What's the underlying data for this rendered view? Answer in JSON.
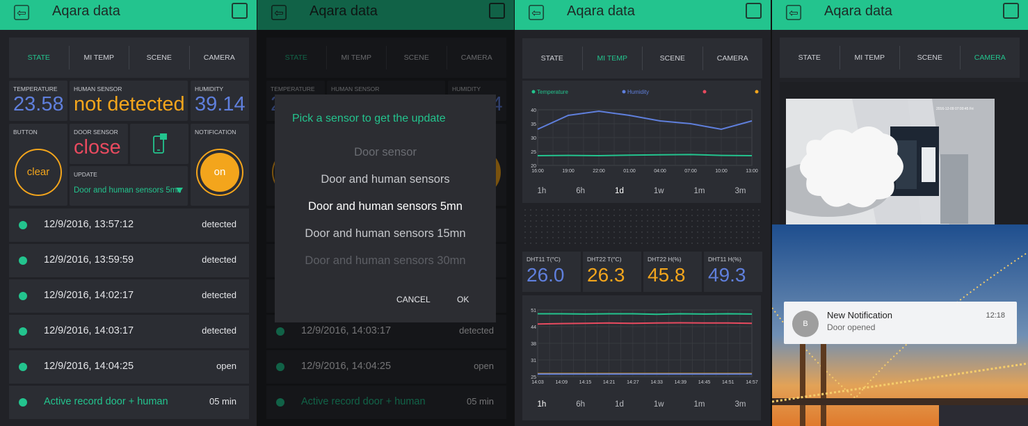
{
  "app": {
    "title": "Aqara data"
  },
  "tabs": [
    "STATE",
    "MI TEMP",
    "SCENE",
    "CAMERA"
  ],
  "state": {
    "temperature_label": "TEMPERATURE",
    "temperature": "23.58",
    "human_label": "HUMAN SENSOR",
    "human": "not detected",
    "humidity_label": "HUMIDITY",
    "humidity": "39.14",
    "button_label": "BUTTON",
    "button_value": "clear",
    "door_label": "DOOR SENSOR",
    "door": "close",
    "notification_label": "NOTIFICATION",
    "notification_value": "on",
    "update_label": "UPDATE",
    "update_value": "Door and human sensors 5mn",
    "records": [
      {
        "time": "12/9/2016, 13:57:12",
        "value": "detected"
      },
      {
        "time": "12/9/2016, 13:59:59",
        "value": "detected"
      },
      {
        "time": "12/9/2016, 14:02:17",
        "value": "detected"
      },
      {
        "time": "12/9/2016, 14:03:17",
        "value": "detected"
      },
      {
        "time": "12/9/2016, 14:04:25",
        "value": "open"
      }
    ],
    "active_label": "Active record door + human",
    "active_value": "05 min"
  },
  "dialog": {
    "title": "Pick a sensor to get the update",
    "options": [
      "Door sensor",
      "Door and human sensors",
      "Door and human sensors 5mn",
      "Door and human sensors 15mn",
      "Door and human sensors 30mn"
    ],
    "selected": "Door and human sensors 5mn",
    "cancel": "CANCEL",
    "ok": "OK"
  },
  "mitemp": {
    "ranges": [
      "1h",
      "6h",
      "1d",
      "1w",
      "1m",
      "3m"
    ],
    "selected_range_top": "1d",
    "selected_range_bottom": "1h",
    "values": [
      {
        "label": "DHT11 T(°C)",
        "value": "26.0",
        "color": "#5f7fdc"
      },
      {
        "label": "DHT22 T(°C)",
        "value": "26.3",
        "color": "#f3a51c"
      },
      {
        "label": "DHT22 H(%)",
        "value": "45.8",
        "color": "#f3a51c"
      },
      {
        "label": "DHT11 H(%)",
        "value": "49.3",
        "color": "#5f7fdc"
      }
    ]
  },
  "chart_data": [
    {
      "type": "line",
      "title": "",
      "x": [
        "16:00",
        "19:00",
        "22:00",
        "01:00",
        "04:00",
        "07:00",
        "10:00",
        "13:00"
      ],
      "ylim": [
        20,
        40
      ],
      "yticks": [
        "20",
        "25",
        "30",
        "35",
        "40"
      ],
      "series": [
        {
          "name": "Temperature",
          "color": "#23c48e",
          "values": [
            23.5,
            23.6,
            23.5,
            23.7,
            23.8,
            23.9,
            23.6,
            23.5
          ]
        },
        {
          "name": "Humidity",
          "color": "#5f7fdc",
          "values": [
            33,
            38,
            39.5,
            38,
            36,
            35,
            33,
            36
          ]
        },
        {
          "color": "#e84a5f",
          "values": []
        },
        {
          "color": "#f3a51c",
          "values": []
        }
      ]
    },
    {
      "type": "line",
      "title": "",
      "x": [
        "14:03",
        "14:09",
        "14:15",
        "14:21",
        "14:27",
        "14:33",
        "14:39",
        "14:45",
        "14:51",
        "14:57"
      ],
      "ylim": [
        25,
        51
      ],
      "yticks": [
        "25",
        "31",
        "38",
        "44",
        "51"
      ],
      "series": [
        {
          "color": "#23c48e",
          "values": [
            49.5,
            49.5,
            49.4,
            49.5,
            49.5,
            49.3,
            49.5,
            49.4,
            49.5,
            49.4
          ]
        },
        {
          "color": "#e84a5f",
          "values": [
            45.5,
            45.7,
            45.8,
            45.9,
            45.8,
            45.9,
            46.0,
            45.9,
            45.9,
            45.8
          ]
        },
        {
          "color": "#f3a51c",
          "values": [
            26.2,
            26.2,
            26.2,
            26.2,
            26.2,
            26.2,
            26.2,
            26.2,
            26.2,
            26.2
          ]
        },
        {
          "color": "#5f7fdc",
          "values": [
            26.0,
            26.0,
            26.0,
            26.0,
            26.0,
            26.0,
            26.0,
            26.0,
            26.0,
            26.0
          ]
        }
      ]
    }
  ],
  "camera": {
    "timestamp": "2016-12-09 07:00:45 Fri",
    "notification_title": "New Notification",
    "notification_body": "Door opened",
    "notification_time": "12:18",
    "avatar_letter": "B"
  }
}
